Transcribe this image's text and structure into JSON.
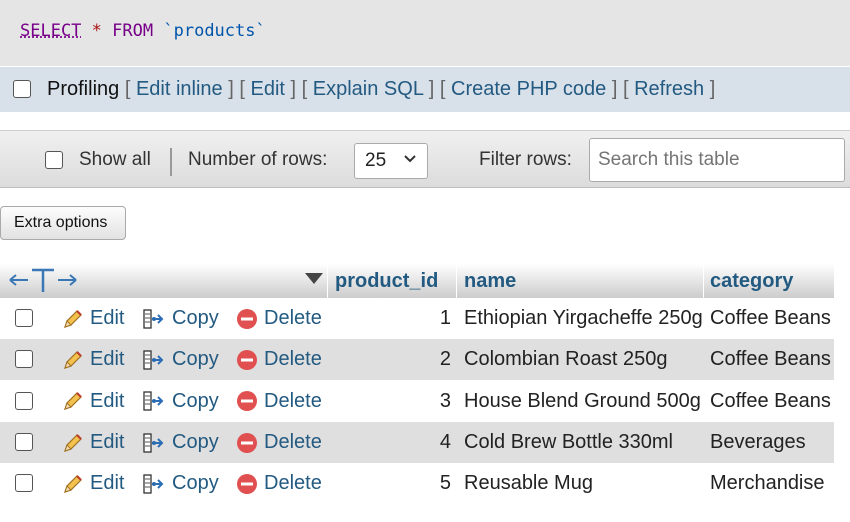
{
  "sql": {
    "select": "SELECT",
    "star": "*",
    "from": "FROM",
    "table": "`products`"
  },
  "profiling": {
    "label": "Profiling",
    "links": [
      "Edit inline",
      "Edit",
      "Explain SQL",
      "Create PHP code",
      "Refresh"
    ]
  },
  "nav": {
    "show_all": "Show all",
    "number_of_rows_label": "Number of rows:",
    "rows_value": "25",
    "filter_label": "Filter rows:",
    "search_placeholder": "Search this table"
  },
  "extra_options": "Extra options",
  "table": {
    "columns": [
      "product_id",
      "name",
      "category"
    ],
    "actions": {
      "edit": "Edit",
      "copy": "Copy",
      "delete": "Delete"
    },
    "rows": [
      {
        "product_id": "1",
        "name": "Ethiopian Yirgacheffe 250g",
        "category": "Coffee Beans"
      },
      {
        "product_id": "2",
        "name": "Colombian Roast 250g",
        "category": "Coffee Beans"
      },
      {
        "product_id": "3",
        "name": "House Blend Ground 500g",
        "category": "Coffee Beans"
      },
      {
        "product_id": "4",
        "name": "Cold Brew Bottle 330ml",
        "category": "Beverages"
      },
      {
        "product_id": "5",
        "name": "Reusable Mug",
        "category": "Merchandise"
      }
    ]
  },
  "icons": {
    "edit": "pencil-icon",
    "copy": "copy-icon",
    "delete": "delete-icon",
    "column-arrows": "column-arrows-icon",
    "sort": "sort-down-icon"
  },
  "colors": {
    "link": "#235a81",
    "keyword": "#770088",
    "delete_red": "#e05050"
  }
}
